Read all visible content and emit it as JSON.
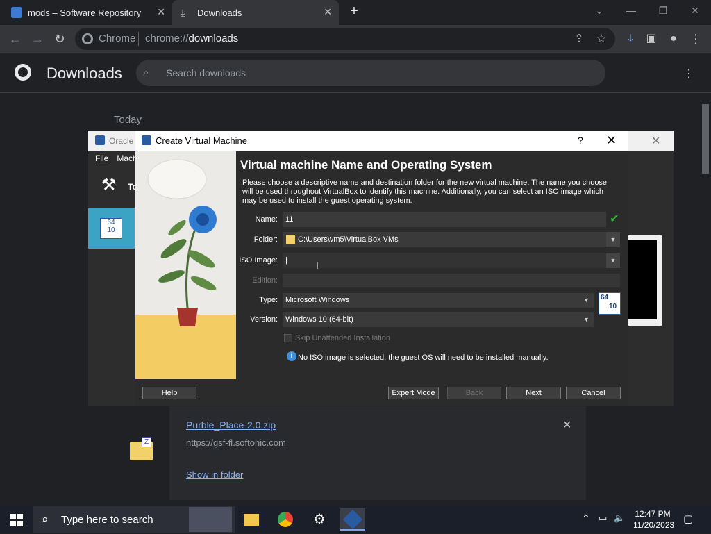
{
  "browser": {
    "tabs": [
      {
        "title": "mods – Software Repository"
      },
      {
        "title": "Downloads"
      }
    ],
    "omnibox": {
      "site_label": "Chrome",
      "url_prefix": "chrome://",
      "url_path": "downloads"
    }
  },
  "downloads": {
    "title": "Downloads",
    "search_placeholder": "Search downloads",
    "section_label": "Today",
    "item": {
      "filename": "Purble_Place-2.0.zip",
      "source": "https://gsf-fl.softonic.com",
      "show_in_folder": "Show in folder"
    }
  },
  "vbox_manager": {
    "title": "Oracle",
    "menu": [
      "File",
      "Machi"
    ],
    "tools_label": "To"
  },
  "dialog": {
    "title": "Create Virtual Machine",
    "help_glyph": "?",
    "heading": "Virtual machine Name and Operating System",
    "description": "Please choose a descriptive name and destination folder for the new virtual machine. The name you choose will be used throughout VirtualBox to identify this machine. Additionally, you can select an ISO image which may be used to install the guest operating system.",
    "fields": {
      "name_label": "Name:",
      "name_value": "11",
      "folder_label": "Folder:",
      "folder_value": "C:\\Users\\vm5\\VirtualBox VMs",
      "iso_label": "ISO Image:",
      "iso_value": "|",
      "edition_label": "Edition:",
      "edition_value": "",
      "type_label": "Type:",
      "type_value": "Microsoft Windows",
      "version_label": "Version:",
      "version_value": "Windows 10 (64-bit)",
      "skip_unattended_label": "Skip Unattended Installation"
    },
    "os_badge": {
      "top": "64",
      "bottom": "10"
    },
    "info_message": "No ISO image is selected, the guest OS will need to be installed manually.",
    "buttons": {
      "help": "Help",
      "expert_mode": "Expert Mode",
      "back": "Back",
      "next": "Next",
      "cancel": "Cancel"
    }
  },
  "taskbar": {
    "search_placeholder": "Type here to search",
    "time": "12:47 PM",
    "date": "11/20/2023"
  },
  "colors": {
    "chrome_dark": "#202124",
    "chrome_toolbar": "#35363a",
    "link_blue": "#8ab4f8",
    "dialog_bg": "#2b2b2b",
    "ok_green": "#2fb52f",
    "vbox_blue": "#3ba3c4"
  },
  "icons": [
    "chrome-logo-icon",
    "search-icon",
    "kebab-menu-icon",
    "back-icon",
    "forward-icon",
    "reload-icon",
    "share-icon",
    "star-icon",
    "download-indicator-icon",
    "side-panel-icon",
    "profile-icon",
    "check-icon",
    "folder-icon",
    "info-icon",
    "windows-start-icon",
    "file-explorer-icon",
    "settings-icon",
    "virtualbox-icon"
  ]
}
